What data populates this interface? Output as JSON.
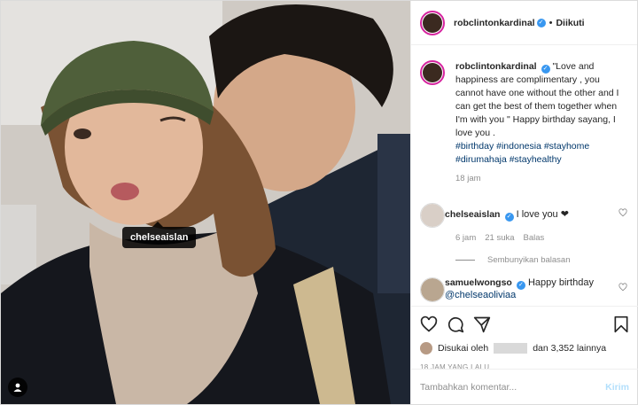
{
  "post": {
    "author": "robclintonkardinal",
    "separator": "•",
    "follow_status": "Diikuti",
    "photo_tag": "chelseaislan"
  },
  "caption": {
    "username": "robclintonkardinal",
    "text": "\"Love and happiness are complimentary , you cannot have one without the other and I can get the best of them together when I'm with you \" Happy birthday sayang, I love you .",
    "hashtags": [
      "#birthday",
      "#indonesia",
      "#stayhome",
      "#dirumahaja",
      "#stayhealthy"
    ],
    "time": "18 jam"
  },
  "comments": [
    {
      "username": "chelseaislan",
      "text": "I love you ❤",
      "time": "6 jam",
      "likes": "21 suka",
      "reply": "Balas",
      "hide_replies": "Sembunyikan balasan"
    },
    {
      "username": "samuelwongso",
      "text": "Happy birthday",
      "mention": "@chelseaoliviaa"
    }
  ],
  "likes": {
    "prefix": "Disukai oleh",
    "suffix": "dan 3,352 lainnya"
  },
  "post_time": "18 JAM YANG LALU",
  "add_comment": {
    "placeholder": "Tambahkan komentar...",
    "post_label": "Kirim"
  },
  "colors": {
    "verified": "#3897f0",
    "link": "#00376b",
    "muted": "#8e8e8e",
    "post_button_disabled": "#b2dffc"
  }
}
